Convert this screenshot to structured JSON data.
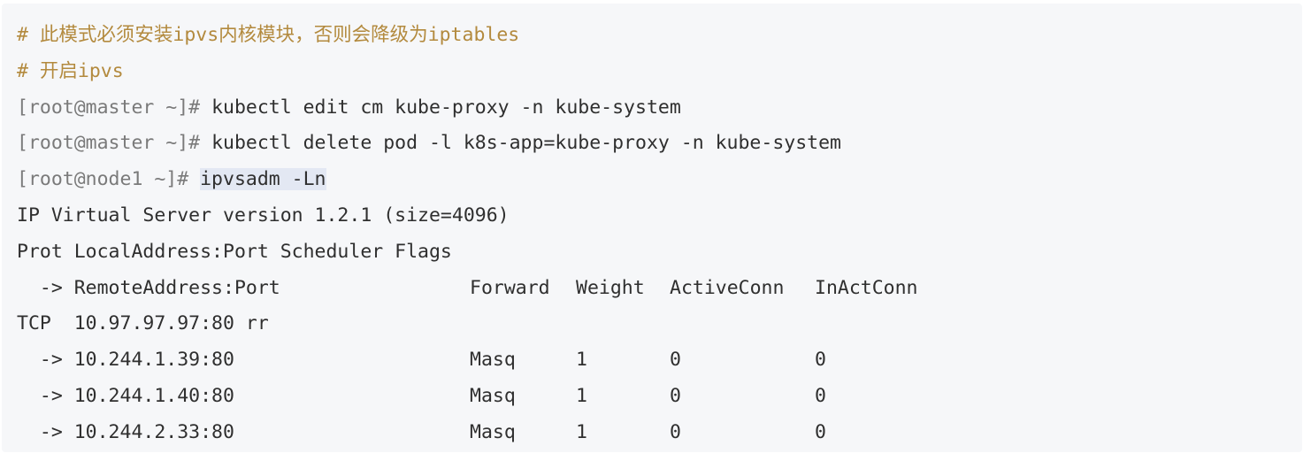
{
  "code": {
    "comments": [
      "# 此模式必须安装ipvs内核模块，否则会降级为iptables",
      "# 开启ipvs"
    ],
    "commands": [
      {
        "prompt": "[root@master ~]# ",
        "command": "kubectl edit cm kube-proxy -n kube-system"
      },
      {
        "prompt": "[root@master ~]# ",
        "command": "kubectl delete pod -l k8s-app=kube-proxy -n kube-system"
      },
      {
        "prompt": "[root@node1 ~]# ",
        "command": "ipvsadm -Ln"
      }
    ],
    "output": {
      "version_line": "IP Virtual Server version 1.2.1 (size=4096)",
      "header_line": "Prot LocalAddress:Port Scheduler Flags",
      "columns": [
        "  -> RemoteAddress:Port",
        "Forward",
        "Weight",
        "ActiveConn",
        "InActConn"
      ],
      "service_line": "TCP  10.97.97.97:80 rr",
      "rows": [
        {
          "address": "  -> 10.244.1.39:80",
          "forward": "Masq",
          "weight": "1",
          "active": "0",
          "inact": "0"
        },
        {
          "address": "  -> 10.244.1.40:80",
          "forward": "Masq",
          "weight": "1",
          "active": "0",
          "inact": "0"
        },
        {
          "address": "  -> 10.244.2.33:80",
          "forward": "Masq",
          "weight": "1",
          "active": "0",
          "inact": "0"
        }
      ]
    }
  },
  "colors": {
    "comment": "#b38a3e",
    "prompt": "#7a7a7a",
    "text": "#2f2f2f",
    "background": "#f6f7f9",
    "selection": "#e3e8f3"
  }
}
